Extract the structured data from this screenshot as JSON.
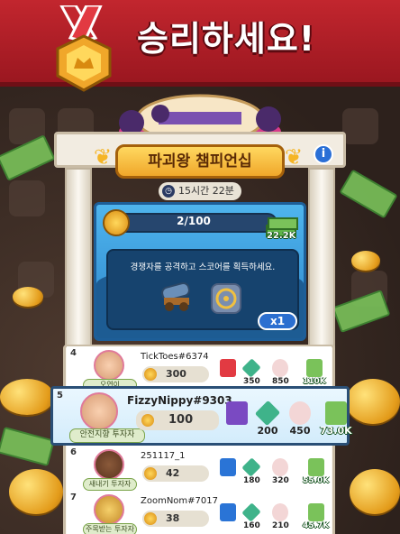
{
  "header": {
    "title": "승리하세요!"
  },
  "event": {
    "name": "파괴왕 챔피언십",
    "timer": "15시간 22분",
    "progress_text": "2/100",
    "progress_fraction": 0.02,
    "reward_value": "22.2K",
    "task_text": "경쟁자를 공격하고 스코어를 획득하세요.",
    "multiplier": "x1"
  },
  "leaderboard": [
    {
      "rank": "4",
      "name": "TickToes#6374",
      "badge": "오연이",
      "score": "300",
      "item2": "350",
      "item3": "850",
      "money": "110K"
    },
    {
      "rank": "5",
      "name": "FizzyNippy#9303",
      "badge": "안전지향 투자자",
      "score": "100",
      "item2": "200",
      "item3": "450",
      "money": "73.0K"
    },
    {
      "rank": "6",
      "name": "251117_1",
      "badge": "새내기 투자자",
      "score": "42",
      "item2": "180",
      "item3": "320",
      "money": "55.0K"
    },
    {
      "rank": "7",
      "name": "ZoomNom#7017",
      "badge": "주목받는 투자자",
      "score": "38",
      "item2": "160",
      "item3": "210",
      "money": "45.7K"
    }
  ],
  "colors": {
    "banner": "#c2262e",
    "gold": "#f0a72a",
    "sky": "#4fb5ee",
    "highlight_border": "#2a4f76"
  }
}
